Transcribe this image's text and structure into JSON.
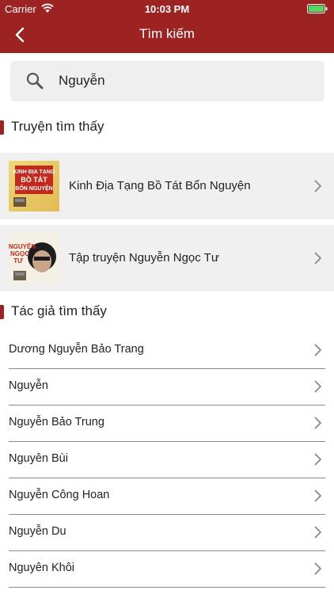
{
  "status_bar": {
    "carrier": "Carrier",
    "time": "10:03 PM"
  },
  "nav": {
    "title": "Tìm kiếm",
    "back_icon": "chevron-left-icon",
    "background": "#9d2323"
  },
  "search": {
    "value": "Nguyễn",
    "icon": "search-icon"
  },
  "stories_section": {
    "title": "Truyện tìm thấy",
    "items": [
      {
        "title": "Kinh Địa Tạng Bồ Tát Bổn Nguyện",
        "cover_text": [
          "KINH ĐỊA TẠNG",
          "BỒ TÁT",
          "BỔN NGUYỆN"
        ]
      },
      {
        "title": "Tập truyện Nguyễn Ngọc Tư",
        "cover_text": [
          "NGUYỄN",
          "NGỌC",
          "TƯ"
        ]
      }
    ]
  },
  "authors_section": {
    "title": "Tác giả tìm thấy",
    "items": [
      {
        "name": "Dương Nguyễn Bảo Trang"
      },
      {
        "name": "Nguyễn"
      },
      {
        "name": "Nguyễn Bảo Trung"
      },
      {
        "name": "Nguyên Bùi"
      },
      {
        "name": "Nguyễn Công Hoan"
      },
      {
        "name": "Nguyễn Du"
      },
      {
        "name": "Nguyên Khôi"
      }
    ]
  },
  "colors": {
    "accent": "#9d2323",
    "row_background": "#f0f0f0",
    "battery": "#4cd964"
  }
}
